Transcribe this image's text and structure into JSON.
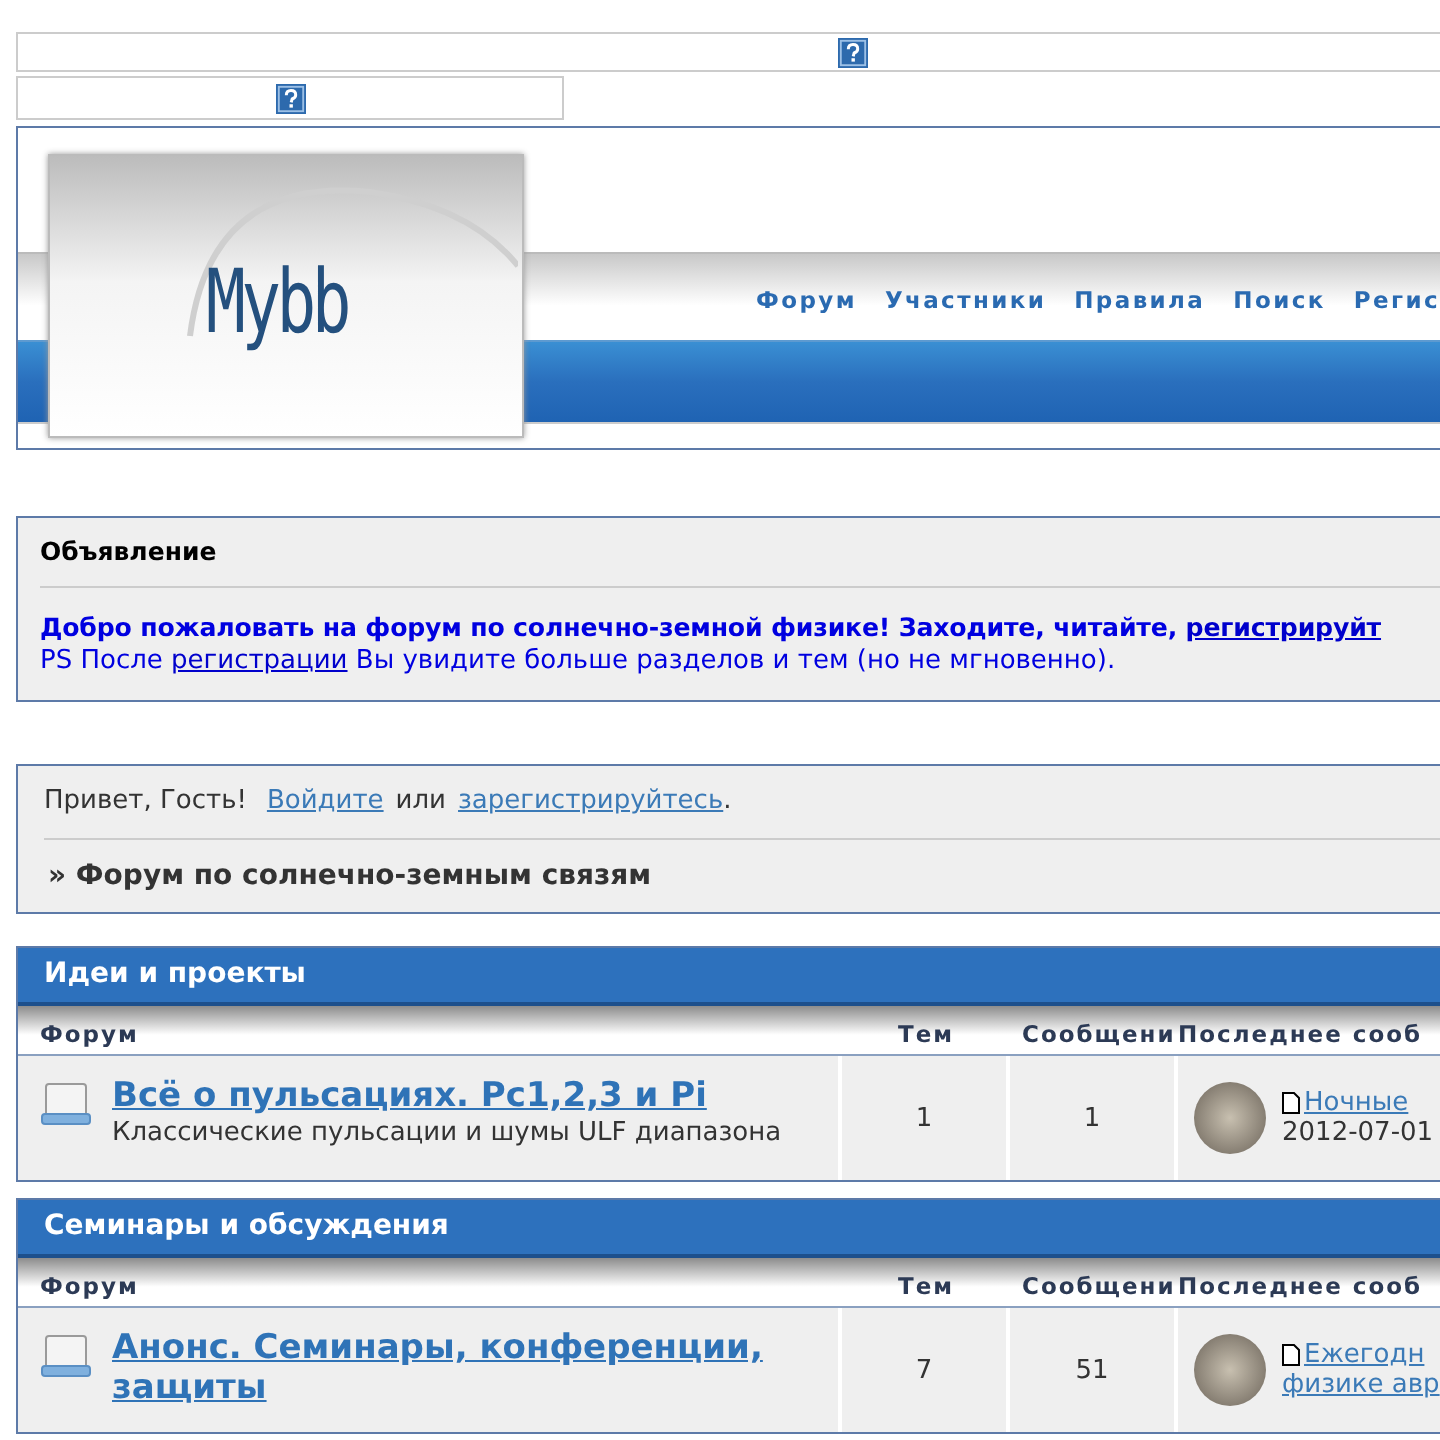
{
  "help_fields": [
    {
      "kind": "wide"
    },
    {
      "kind": "narrow"
    }
  ],
  "header": {
    "logo": "Mybb",
    "nav": [
      "Форум",
      "Участники",
      "Правила",
      "Поиск",
      "Регис"
    ]
  },
  "announcement": {
    "title": "Объявление",
    "line1": "Добро пожаловать на форум по солнечно-земной физике! Заходите, читайте, ",
    "line1_link": "регистрируйт",
    "line2_before": "PS После ",
    "line2_link": "регистрации",
    "line2_after": " Вы увидите больше разделов и тем (но не мгновенно)."
  },
  "welcome": {
    "greeting": "Привет, Гость!",
    "login": "Войдите",
    "or": "или",
    "register": "зарегистрируйтесь",
    "end": ".",
    "breadcrumb": "» Форум по солнечно-земным связям"
  },
  "categories": [
    {
      "title": "Идеи и проекты",
      "columns": [
        "Форум",
        "Тем",
        "Сообщени",
        "Последнее сооб"
      ],
      "forums": [
        {
          "title": "Всё о пульсациях. Pc1,2,3 и Pi",
          "description": "Классические пульсации и шумы ULF диапазона",
          "topics": "1",
          "posts": "1",
          "last_post": [
            "Ночные"
          ],
          "last_date": "2012-07-01"
        }
      ]
    },
    {
      "title": "Семинары и обсуждения",
      "columns": [
        "Форум",
        "Тем",
        "Сообщени",
        "Последнее сооб"
      ],
      "forums": [
        {
          "title": "Анонс. Семинары, конференции, защиты",
          "topics": "7",
          "posts": "51",
          "last_post": [
            "Ежегодн",
            "физике авр"
          ]
        }
      ]
    }
  ]
}
